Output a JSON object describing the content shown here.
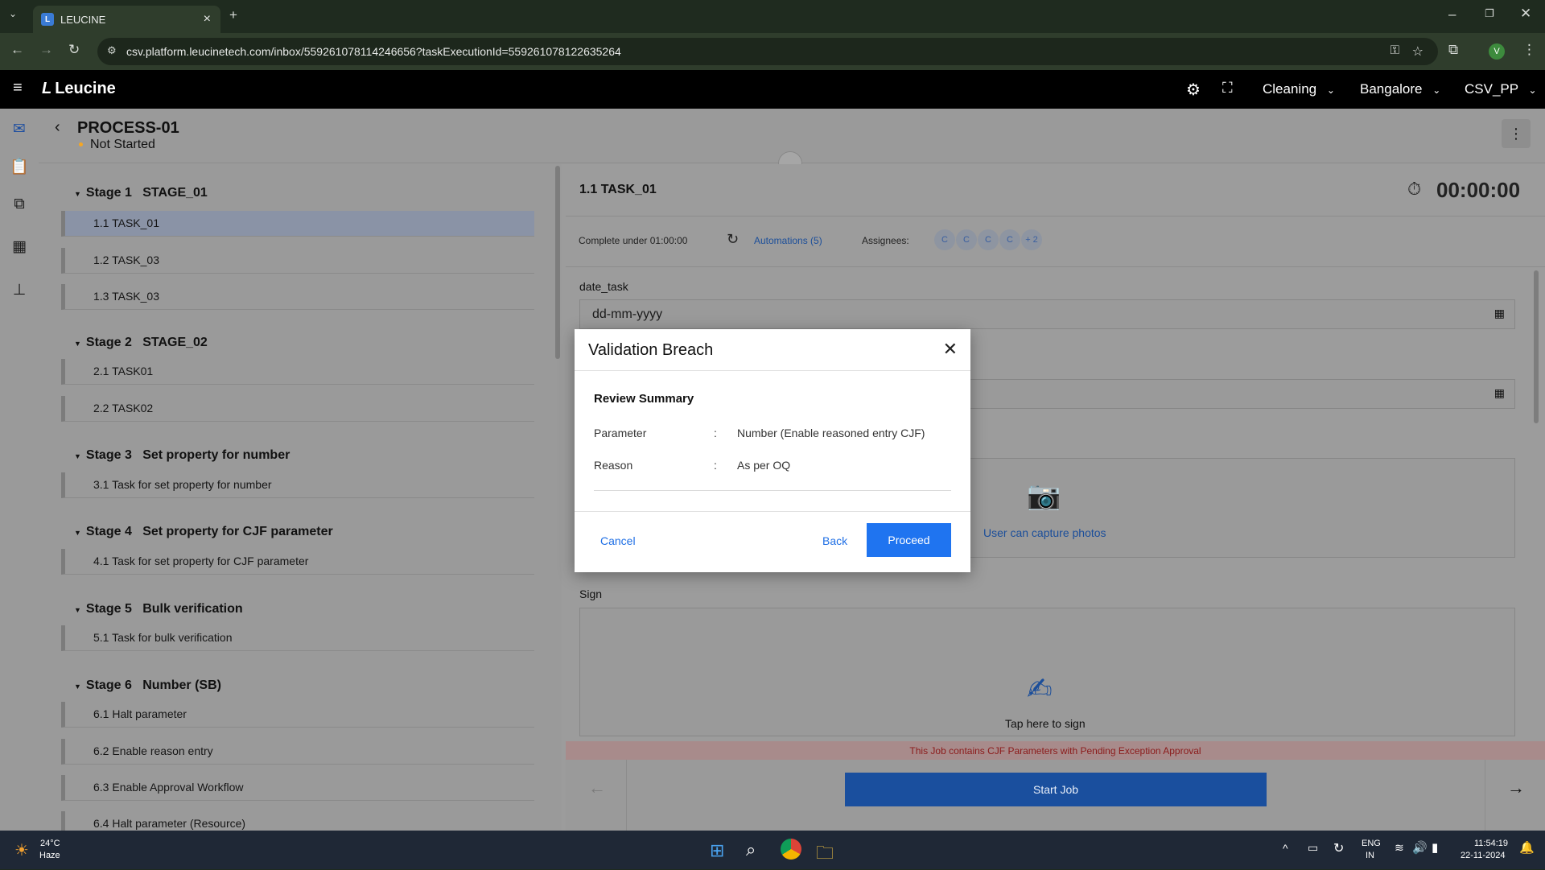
{
  "browser": {
    "tab_title": "LEUCINE",
    "url": "csv.platform.leucinetech.com/inbox/559261078114246656?taskExecutionId=559261078122635264"
  },
  "header": {
    "logo": "Leucine",
    "facility_dropdown": "Cleaning",
    "site_dropdown": "Bangalore",
    "user_dropdown": "CSV_PP"
  },
  "process": {
    "title": "PROCESS-01",
    "status": "Not Started"
  },
  "stages": [
    {
      "num": "Stage 1",
      "name": "STAGE_01",
      "tasks": [
        "1.1  TASK_01",
        "1.2  TASK_03",
        "1.3  TASK_03"
      ]
    },
    {
      "num": "Stage 2",
      "name": "STAGE_02",
      "tasks": [
        "2.1  TASK01",
        "2.2  TASK02"
      ]
    },
    {
      "num": "Stage 3",
      "name": "Set property for number",
      "tasks": [
        "3.1  Task for set property for number"
      ]
    },
    {
      "num": "Stage 4",
      "name": "Set property for CJF parameter",
      "tasks": [
        "4.1  Task for set property for CJF parameter"
      ]
    },
    {
      "num": "Stage 5",
      "name": "Bulk verification",
      "tasks": [
        "5.1  Task for bulk verification"
      ]
    },
    {
      "num": "Stage 6",
      "name": "Number (SB)",
      "tasks": [
        "6.1  Halt parameter",
        "6.2  Enable reason entry",
        "6.3  Enable Approval Workflow",
        "6.4  Halt parameter (Resource)"
      ]
    }
  ],
  "task": {
    "title": "1.1 TASK_01",
    "timer": "00:00:00",
    "complete_under": "Complete under 01:00:00",
    "automations": "Automations (5)",
    "assignees_label": "Assignees:",
    "assignees": [
      "C",
      "C",
      "C",
      "C",
      "+ 2"
    ],
    "date_label": "date_task",
    "date_placeholder": "dd-mm-yyyy",
    "photo_text": "User can capture photos",
    "sign_label": "Sign",
    "sign_text": "Tap here to sign",
    "warning": "This Job contains CJF Parameters with Pending Exception Approval",
    "start_button": "Start Job"
  },
  "modal": {
    "title": "Validation Breach",
    "review_title": "Review Summary",
    "rows": [
      {
        "label": "Parameter",
        "value": "Number (Enable reasoned entry CJF)"
      },
      {
        "label": "Reason",
        "value": "As per OQ"
      }
    ],
    "colon": ":",
    "cancel": "Cancel",
    "back": "Back",
    "proceed": "Proceed"
  },
  "taskbar": {
    "temp": "24°C",
    "weather": "Haze",
    "lang1": "ENG",
    "lang2": "IN",
    "time": "11:54:19",
    "date": "22-11-2024"
  },
  "colors": {
    "accent": "#1f74f0",
    "warning_text": "#c0392b",
    "status_dot": "#f5a623"
  }
}
